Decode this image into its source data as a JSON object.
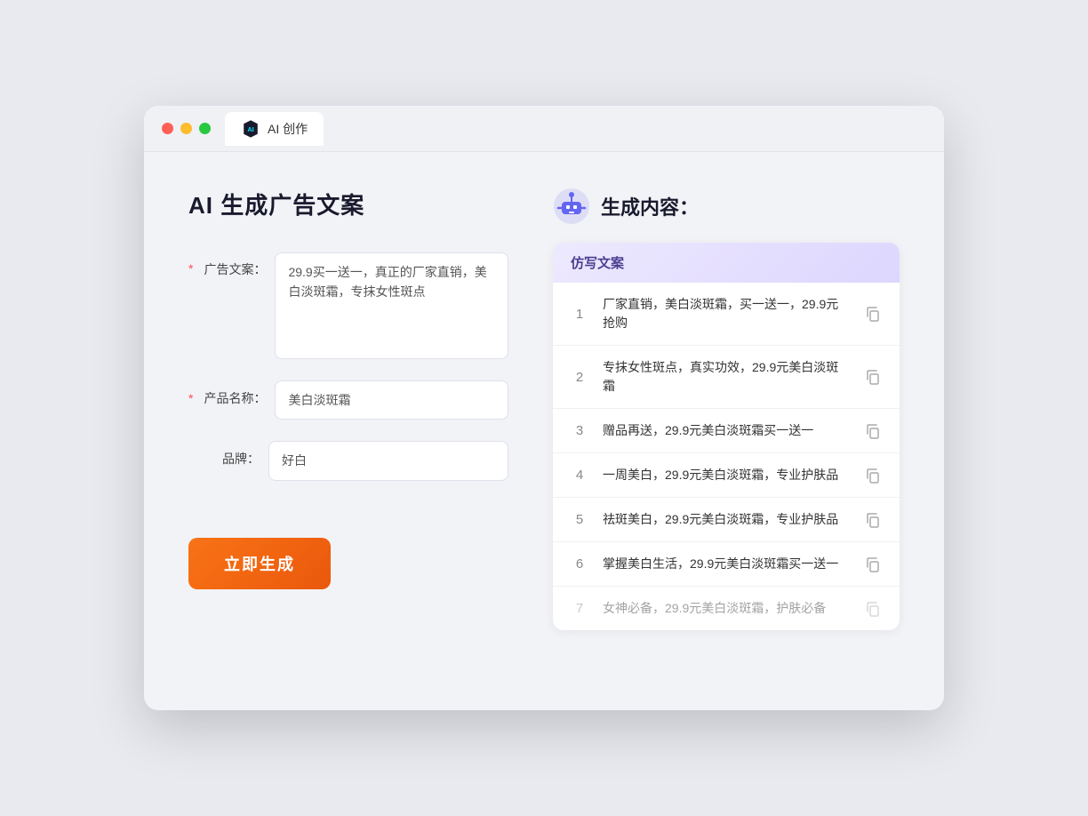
{
  "window": {
    "tab_label": "AI 创作"
  },
  "left": {
    "title": "AI 生成广告文案",
    "fields": [
      {
        "id": "ad_copy",
        "label": "广告文案：",
        "required": true,
        "type": "textarea",
        "value": "29.9买一送一，真正的厂家直销，美白淡斑霜，专抹女性斑点"
      },
      {
        "id": "product_name",
        "label": "产品名称：",
        "required": true,
        "type": "input",
        "value": "美白淡斑霜"
      },
      {
        "id": "brand",
        "label": "品牌：",
        "required": false,
        "type": "input",
        "value": "好白"
      }
    ],
    "generate_button": "立即生成"
  },
  "right": {
    "title": "生成内容：",
    "table_header": "仿写文案",
    "results": [
      {
        "num": "1",
        "text": "厂家直销，美白淡斑霜，买一送一，29.9元抢购",
        "faded": false
      },
      {
        "num": "2",
        "text": "专抹女性斑点，真实功效，29.9元美白淡斑霜",
        "faded": false
      },
      {
        "num": "3",
        "text": "赠品再送，29.9元美白淡斑霜买一送一",
        "faded": false
      },
      {
        "num": "4",
        "text": "一周美白，29.9元美白淡斑霜，专业护肤品",
        "faded": false
      },
      {
        "num": "5",
        "text": "祛斑美白，29.9元美白淡斑霜，专业护肤品",
        "faded": false
      },
      {
        "num": "6",
        "text": "掌握美白生活，29.9元美白淡斑霜买一送一",
        "faded": false
      },
      {
        "num": "7",
        "text": "女神必备，29.9元美白淡斑霜，护肤必备",
        "faded": true
      }
    ]
  },
  "colors": {
    "accent_orange": "#f97316",
    "accent_purple": "#7c3aed",
    "required_star": "#ff4d4f"
  }
}
